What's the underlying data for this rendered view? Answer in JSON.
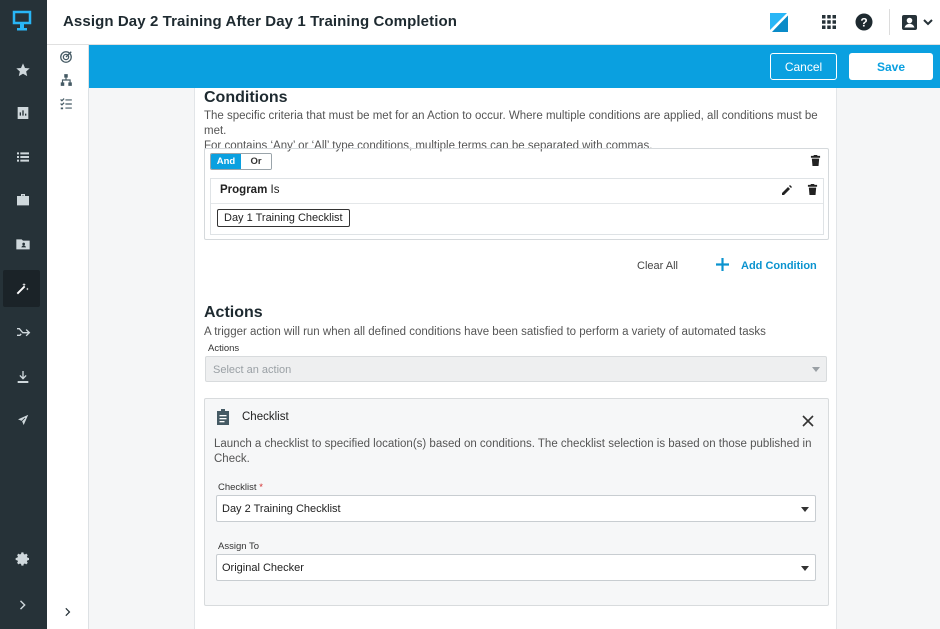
{
  "header": {
    "title": "Assign Day 2 Training After Day 1 Training Completion"
  },
  "actionbar": {
    "cancel_label": "Cancel",
    "save_label": "Save"
  },
  "colors": {
    "accent": "#0aa0e0",
    "rail": "#263238"
  },
  "rail_icons": [
    "logo-icon",
    "star-icon",
    "reports-icon",
    "list-icon",
    "briefcase-icon",
    "folder-user-icon",
    "magic-wand-icon",
    "merge-arrow-icon",
    "download-icon",
    "send-icon",
    "gear-icon",
    "chevron-right-icon"
  ],
  "subrail_icons": [
    "target-icon",
    "hierarchy-icon",
    "checklist-icon",
    "chevron-right-icon"
  ],
  "conditions": {
    "heading": "Conditions",
    "description_1": "The specific criteria that must be met for an Action to occur. Where multiple conditions are applied, all conditions must be met.",
    "description_2": "For contains ‘Any’ or ‘All’ type conditions, multiple terms can be separated with commas.",
    "toggle_and": "And",
    "toggle_or": "Or",
    "rule": {
      "field": "Program",
      "operator": "Is",
      "value": "Day 1 Training Checklist"
    },
    "clear_all": "Clear All",
    "add_condition": "Add Condition"
  },
  "actions": {
    "heading": "Actions",
    "description": "A trigger action will run when all defined conditions have been satisfied to perform a variety of automated tasks",
    "select_label": "Actions",
    "select_placeholder": "Select an action",
    "card": {
      "title": "Checklist",
      "description_1": "Launch a checklist to specified location(s) based on conditions. The checklist selection is based on those published in",
      "description_2": "Check.",
      "checklist_label": "Checklist",
      "required_mark": "*",
      "checklist_value": "Day 2 Training Checklist",
      "assign_label": "Assign To",
      "assign_value": "Original Checker"
    }
  }
}
